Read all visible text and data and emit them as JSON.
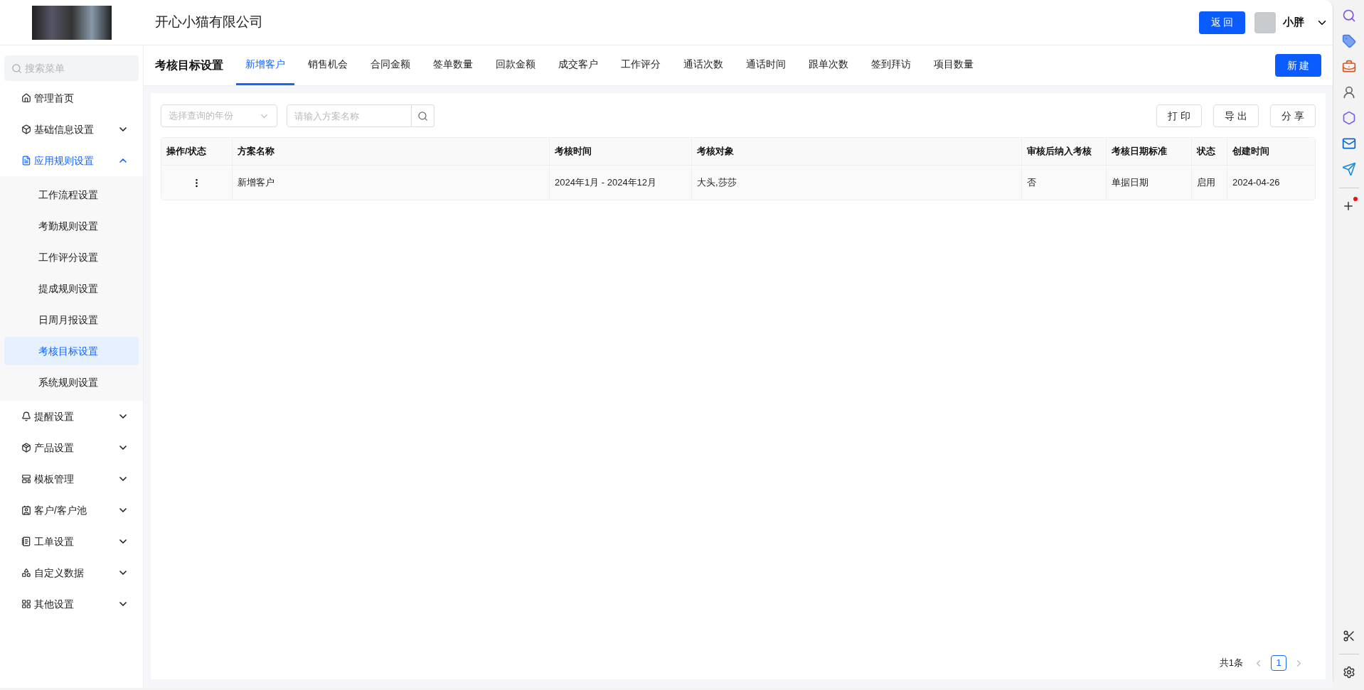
{
  "header": {
    "company": "开心小猫有限公司",
    "back_button": "返 回",
    "user": {
      "name": "小胖"
    }
  },
  "sidebar": {
    "search": {
      "placeholder": "搜索菜单"
    },
    "items": [
      {
        "label": "管理首页",
        "expandable": false,
        "expanded": false
      },
      {
        "label": "基础信息设置",
        "expandable": true,
        "expanded": false
      },
      {
        "label": "应用规则设置",
        "expandable": true,
        "expanded": true,
        "children": [
          {
            "label": "工作流程设置",
            "selected": false
          },
          {
            "label": "考勤规则设置",
            "selected": false
          },
          {
            "label": "工作评分设置",
            "selected": false
          },
          {
            "label": "提成规则设置",
            "selected": false
          },
          {
            "label": "日周月报设置",
            "selected": false
          },
          {
            "label": "考核目标设置",
            "selected": true
          },
          {
            "label": "系统规则设置",
            "selected": false
          }
        ]
      },
      {
        "label": "提醒设置",
        "expandable": true,
        "expanded": false
      },
      {
        "label": "产品设置",
        "expandable": true,
        "expanded": false
      },
      {
        "label": "模板管理",
        "expandable": true,
        "expanded": false
      },
      {
        "label": "客户/客户池",
        "expandable": true,
        "expanded": false
      },
      {
        "label": "工单设置",
        "expandable": true,
        "expanded": false
      },
      {
        "label": "自定义数据",
        "expandable": true,
        "expanded": false
      },
      {
        "label": "其他设置",
        "expandable": true,
        "expanded": false
      }
    ]
  },
  "page_title": "考核目标设置",
  "tabs": [
    {
      "label": "新增客户",
      "selected": true
    },
    {
      "label": "销售机会",
      "selected": false
    },
    {
      "label": "合同金额",
      "selected": false
    },
    {
      "label": "签单数量",
      "selected": false
    },
    {
      "label": "回款金额",
      "selected": false
    },
    {
      "label": "成交客户",
      "selected": false
    },
    {
      "label": "工作评分",
      "selected": false
    },
    {
      "label": "通话次数",
      "selected": false
    },
    {
      "label": "通话时间",
      "selected": false
    },
    {
      "label": "跟单次数",
      "selected": false
    },
    {
      "label": "签到拜访",
      "selected": false
    },
    {
      "label": "项目数量",
      "selected": false
    }
  ],
  "new_button": "新 建",
  "filters": {
    "year_select": {
      "placeholder": "选择查询的年份"
    },
    "name_search": {
      "placeholder": "请输入方案名称"
    }
  },
  "actions": [
    "打 印",
    "导 出",
    "分 享"
  ],
  "table": {
    "columns": [
      "操作/状态",
      "方案名称",
      "考核时间",
      "考核对象",
      "审核后纳入考核",
      "考核日期标准",
      "状态",
      "创建时间"
    ],
    "rows": [
      {
        "name": "新增客户",
        "period": "2024年1月 - 2024年12月",
        "targets": "大头,莎莎",
        "include_after_review": "否",
        "date_standard": "单据日期",
        "status": "启用",
        "created": "2024-04-26"
      }
    ]
  },
  "pagination": {
    "total": "共1条",
    "pages": [
      {
        "label": "1",
        "selected": true
      }
    ]
  }
}
